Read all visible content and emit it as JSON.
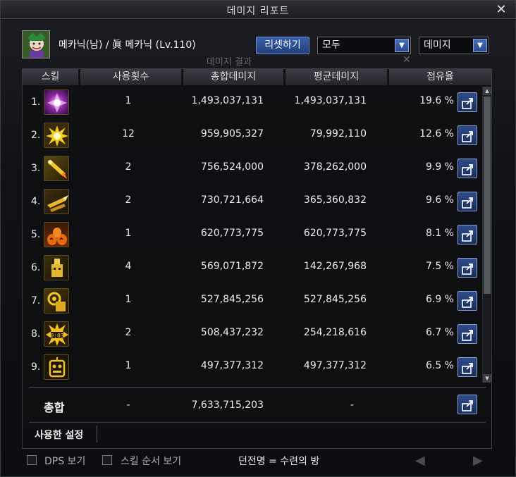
{
  "window": {
    "title": "데미지 리포트"
  },
  "header": {
    "character": "메카닉(남) / 眞 메카닉 (Lv.110)",
    "reset_button": "리셋하기",
    "filter_select": "모두",
    "type_select": "데미지",
    "faint_label": "데미지 결과"
  },
  "table": {
    "columns": [
      "스킬",
      "사용횟수",
      "총합데미지",
      "평균데미지",
      "점유율"
    ],
    "rows": [
      {
        "rank": "1.",
        "icon": "purple-burst-icon",
        "count": "1",
        "total": "1,493,037,131",
        "avg": "1,493,037,131",
        "share": "19.6 %"
      },
      {
        "rank": "2.",
        "icon": "yellow-explosion-icon",
        "count": "12",
        "total": "959,905,327",
        "avg": "79,992,110",
        "share": "12.6 %"
      },
      {
        "rank": "3.",
        "icon": "rocket-icon",
        "count": "2",
        "total": "756,524,000",
        "avg": "378,262,000",
        "share": "9.9 %"
      },
      {
        "rank": "4.",
        "icon": "missile-icon",
        "count": "2",
        "total": "730,721,664",
        "avg": "365,360,832",
        "share": "9.6 %"
      },
      {
        "rank": "5.",
        "icon": "pumpkin-bomb-icon",
        "count": "1",
        "total": "620,773,775",
        "avg": "620,773,775",
        "share": "8.1 %"
      },
      {
        "rank": "6.",
        "icon": "robot-drop-icon",
        "count": "4",
        "total": "569,071,872",
        "avg": "142,267,968",
        "share": "7.5 %"
      },
      {
        "rank": "7.",
        "icon": "gear-robot-icon",
        "count": "1",
        "total": "527,845,256",
        "avg": "527,845,256",
        "share": "6.9 %"
      },
      {
        "rank": "8.",
        "icon": "timer-bomb-icon",
        "count": "2",
        "total": "508,437,232",
        "avg": "254,218,616",
        "share": "6.7 %"
      },
      {
        "rank": "9.",
        "icon": "robot-face-icon",
        "count": "1",
        "total": "497,377,312",
        "avg": "497,377,312",
        "share": "6.5 %"
      }
    ]
  },
  "total": {
    "label": "총합",
    "count": "-",
    "total": "7,633,715,203",
    "avg": "-"
  },
  "settings": {
    "label": "사용한 설정"
  },
  "footer": {
    "dps_toggle": "DPS 보기",
    "skill_order_toggle": "스킬 순서 보기",
    "dungeon": "던전명 = 수련의 방"
  },
  "colors": {
    "accent": "#2a4a90",
    "panel_border": "#3a3c42"
  }
}
